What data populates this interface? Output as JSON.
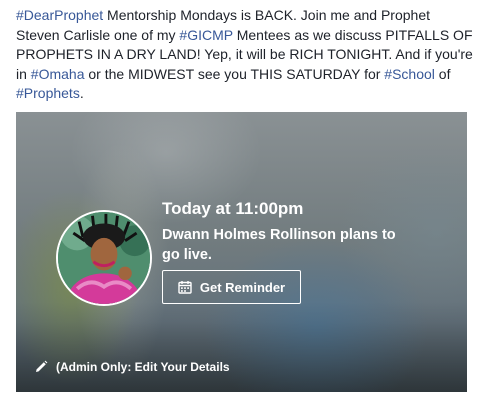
{
  "post": {
    "segments": [
      {
        "text": "#DearProphet",
        "tag": true
      },
      {
        "text": " Mentorship Mondays is BACK. Join me and Prophet Steven Carlisle one of my ",
        "tag": false
      },
      {
        "text": "#GICMP",
        "tag": true
      },
      {
        "text": " Mentees as we discuss PITFALLS OF PROPHETS IN A DRY LAND! Yep, it will be RICH TONIGHT. And if you're in ",
        "tag": false
      },
      {
        "text": "#Omaha",
        "tag": true
      },
      {
        "text": " or the MIDWEST see you THIS SATURDAY for ",
        "tag": false
      },
      {
        "text": "#School",
        "tag": true
      },
      {
        "text": " of ",
        "tag": false
      },
      {
        "text": "#Prophets",
        "tag": true
      },
      {
        "text": ".",
        "tag": false
      }
    ],
    "hashtag_color": "#385898"
  },
  "event": {
    "time": "Today at 11:00pm",
    "description": "Dwann Holmes Rollinson plans to go live.",
    "reminder_button": "Get Reminder",
    "admin_link": "(Admin Only: Edit Your Details",
    "avatar_icon": "profile-photo",
    "calendar_icon": "calendar-icon",
    "edit_icon": "pencil-icon"
  }
}
